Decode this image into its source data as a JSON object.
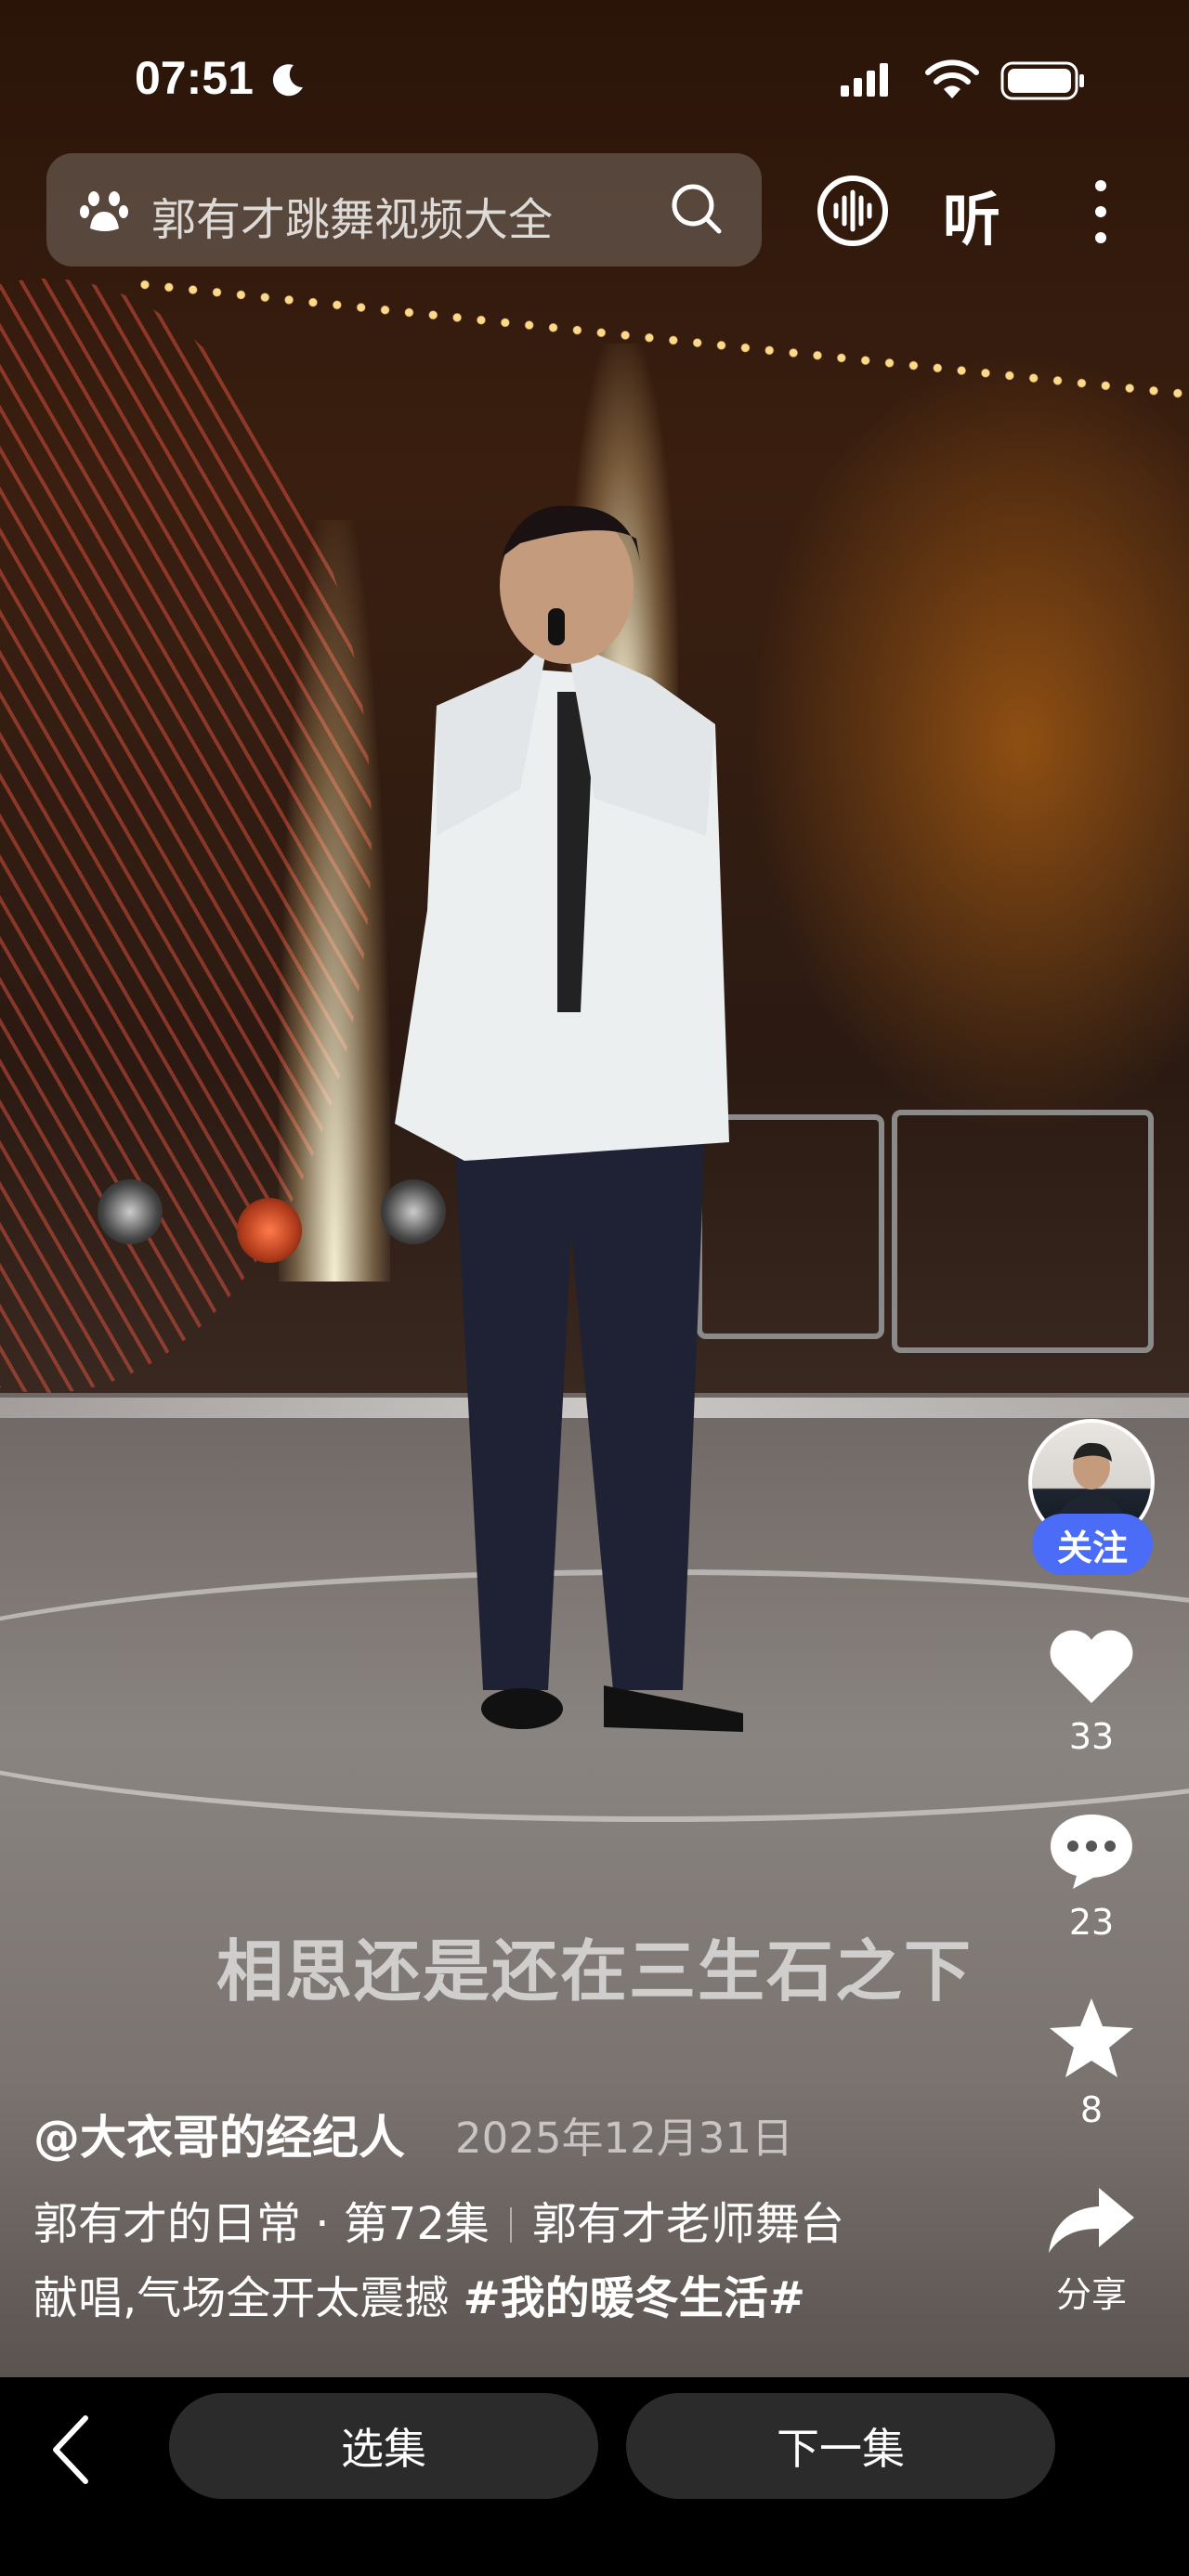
{
  "status_bar": {
    "time": "07:51"
  },
  "search": {
    "query": "郭有才跳舞视频大全"
  },
  "header": {
    "listen_label": "听"
  },
  "video": {
    "lyric": "相思还是还在三生石之下"
  },
  "rail": {
    "follow_label": "关注",
    "likes": "33",
    "comments": "23",
    "favorites": "8",
    "share_label": "分享"
  },
  "post": {
    "author": "@大衣哥的经纪人",
    "date": "2025年12月31日",
    "series": "郭有才的日常 · 第72集",
    "caption_line1": "郭有才老师舞台",
    "caption_line2": "献唱,气场全开太震撼",
    "hashtag": "#我的暖冬生活#"
  },
  "bottom_bar": {
    "select_label": "选集",
    "next_label": "下一集"
  },
  "colors": {
    "follow_button": "#4a6cf7",
    "bottom_pill": "#2b2b2b"
  }
}
